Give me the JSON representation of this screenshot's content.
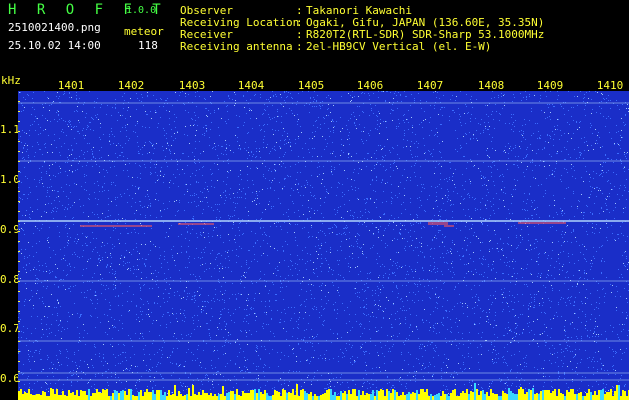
{
  "header": {
    "app_name": "H R O F F T",
    "version": "1.0.0",
    "filename": "2510021400.png",
    "datetime": "25.10.02 14:00",
    "meteor_label": "meteor",
    "meteor_count": "118",
    "info": [
      {
        "key": "Observer",
        "sep": ":",
        "value": "Takanori Kawachi"
      },
      {
        "key": "Receiving Location",
        "sep": ":",
        "value": "Ogaki, Gifu, JAPAN (136.60E, 35.35N)"
      },
      {
        "key": "Receiver",
        "sep": ":",
        "value": "R820T2(RTL-SDR) SDR-Sharp 53.1000MHz"
      },
      {
        "key": "Receiving antenna",
        "sep": ":",
        "value": "2el-HB9CV Vertical (el. E-W)"
      }
    ]
  },
  "axes": {
    "y_unit": "kHz",
    "x_ticks": [
      "1401",
      "1402",
      "1403",
      "1404",
      "1405",
      "1406",
      "1407",
      "1408",
      "1409",
      "1410"
    ],
    "y_ticks": [
      "1.1",
      "1.0",
      "0.9",
      "0.8",
      "0.7",
      "0.6"
    ]
  },
  "colors": {
    "background": "#1a2ec8",
    "noise": "#3a6cff",
    "grid_line": "#b8dcff",
    "signal": "#ff5a5a",
    "bottom_bar": "#ffff00"
  }
}
